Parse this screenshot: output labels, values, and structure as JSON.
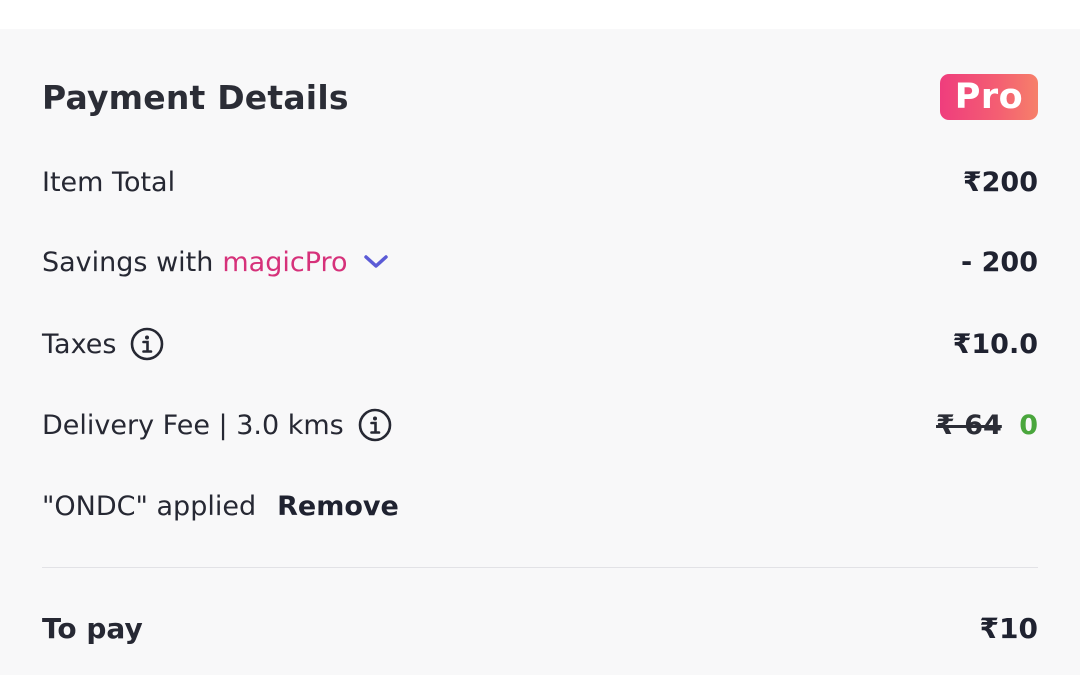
{
  "header": {
    "title": "Payment Details",
    "badge": "Pro"
  },
  "rows": {
    "item_total": {
      "label": "Item Total",
      "value": "₹200"
    },
    "savings": {
      "label": "Savings with",
      "brand": "magicPro",
      "value": "- 200"
    },
    "taxes": {
      "label": "Taxes",
      "value": "₹10.0"
    },
    "delivery": {
      "label": "Delivery Fee | 3.0 kms",
      "original_value": "₹ 64",
      "value": "0"
    },
    "coupon": {
      "label": "\"ONDC\" applied",
      "action": "Remove"
    }
  },
  "total": {
    "label": "To pay",
    "value": "₹10"
  },
  "icons": {
    "savings_toggle": "chevron-down-icon",
    "taxes_info": "info-icon",
    "delivery_info": "info-icon"
  },
  "colors": {
    "brand_pink": "#d6317a",
    "savings_green": "#4aa63d",
    "chevron_purple": "#5b5bd6",
    "badge_gradient": [
      "#ef3d7d",
      "#f6806a"
    ]
  }
}
